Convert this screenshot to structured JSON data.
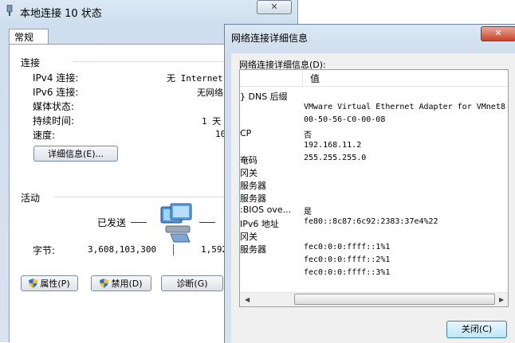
{
  "main_window": {
    "title": "本地连接 10 状态",
    "close_glyph": "✕",
    "tab_label": "常规",
    "connection_section": "连接",
    "fields": [
      {
        "label": "IPv4 连接:",
        "value": "无 Internet"
      },
      {
        "label": "IPv6 连接:",
        "value": "无网络"
      },
      {
        "label": "媒体状态:",
        "value": ""
      },
      {
        "label": "持续时间:",
        "value": "1 天"
      },
      {
        "label": "速度:",
        "value": "10"
      }
    ],
    "details_button": "详细信息(E)...",
    "activity_section": "活动",
    "sent_label": "已发送",
    "bytes_label": "字节:",
    "bytes_sent": "3,608,103,300",
    "bytes_received": "1,592",
    "properties_button": "属性(P)",
    "disable_button": "禁用(D)",
    "diagnose_button": "诊断(G)"
  },
  "details_window": {
    "title": "网络连接详细信息",
    "close_glyph": "✕",
    "caption": "网络连接详细信息(D):",
    "column_value": "值",
    "rows": [
      {
        "key": "} DNS 后缀",
        "value": ""
      },
      {
        "key": "",
        "value": "VMware Virtual Ethernet Adapter for VMnet8"
      },
      {
        "key": "",
        "value": "00-50-56-C0-00-08"
      },
      {
        "key": "CP",
        "value": "否"
      },
      {
        "key": "",
        "value": "192.168.11.2"
      },
      {
        "key": "奄码",
        "value": "255.255.255.0"
      },
      {
        "key": "冈关",
        "value": ""
      },
      {
        "key": "服务器",
        "value": ""
      },
      {
        "key": " 服务器",
        "value": ""
      },
      {
        "key": ":BIOS ove...",
        "value": "是"
      },
      {
        "key": " IPv6 地址",
        "value": "fe80::8c87:6c92:2383:37e4%22"
      },
      {
        "key": "冈关",
        "value": ""
      },
      {
        "key": "服务器",
        "value": "fec0:0:0:ffff::1%1"
      },
      {
        "key": "",
        "value": "fec0:0:0:ffff::2%1"
      },
      {
        "key": "",
        "value": "fec0:0:0:ffff::3%1"
      }
    ],
    "close_button": "关闭(C)",
    "scroll_left": "◀",
    "scroll_right": "▶"
  },
  "colors": {
    "title_bg": "#d6e3f0",
    "close_red": "#c7432a"
  }
}
